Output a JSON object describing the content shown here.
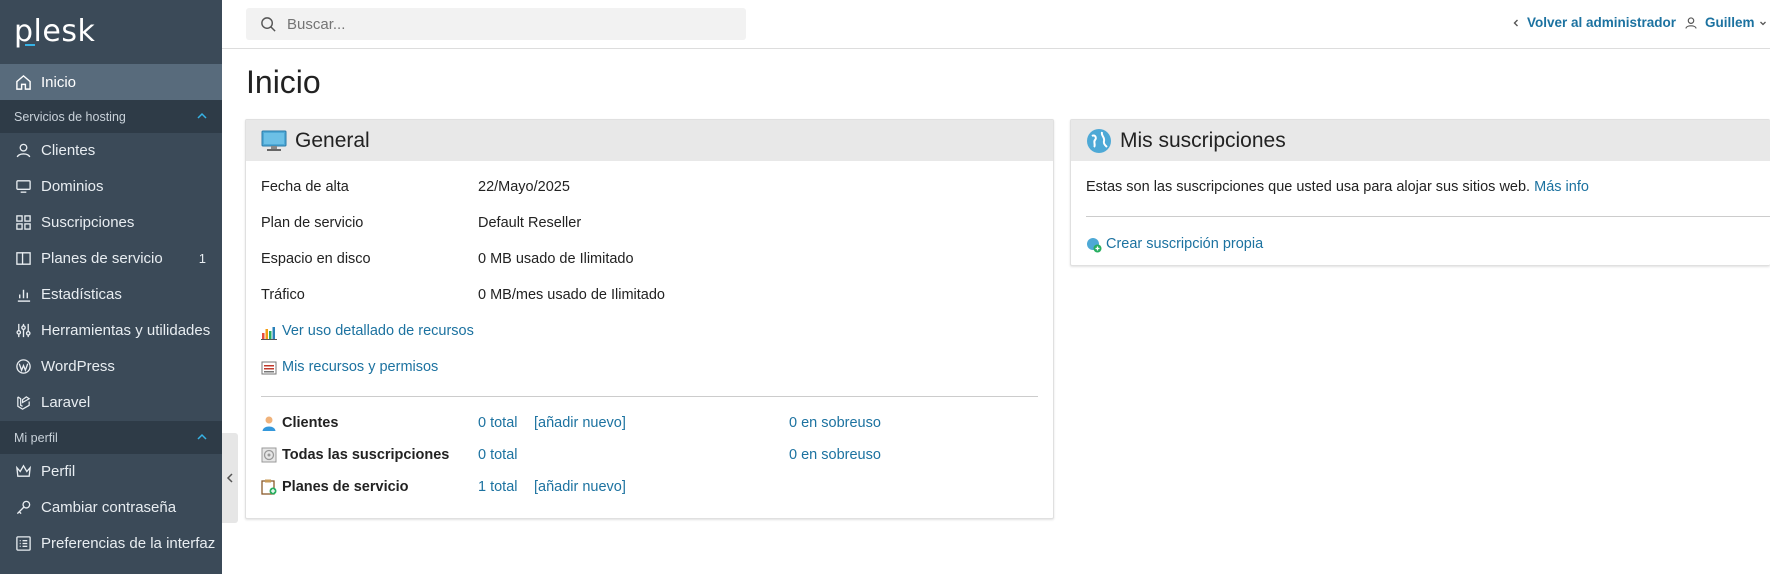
{
  "sidebar": {
    "logo": "plesk",
    "items": [
      {
        "label": "Inicio",
        "icon": "home-icon",
        "active": true
      },
      {
        "label": "Clientes",
        "icon": "user-icon"
      },
      {
        "label": "Dominios",
        "icon": "monitor-icon"
      },
      {
        "label": "Suscripciones",
        "icon": "grid-icon"
      },
      {
        "label": "Planes de servicio",
        "icon": "book-icon",
        "count": "1"
      },
      {
        "label": "Estadísticas",
        "icon": "bar-chart-icon"
      },
      {
        "label": "Herramientas y utilidades",
        "icon": "sliders-icon"
      },
      {
        "label": "WordPress",
        "icon": "wordpress-icon"
      },
      {
        "label": "Laravel",
        "icon": "laravel-icon"
      },
      {
        "label": "Perfil",
        "icon": "crown-icon"
      },
      {
        "label": "Cambiar contraseña",
        "icon": "key-icon"
      },
      {
        "label": "Preferencias de la interfaz",
        "icon": "list-icon"
      }
    ],
    "sections": [
      {
        "label": "Servicios de hosting"
      },
      {
        "label": "Mi perfil"
      }
    ]
  },
  "header": {
    "search_placeholder": "Buscar...",
    "back_link": "Volver al administrador",
    "user": "Guillem"
  },
  "page": {
    "title": "Inicio"
  },
  "general": {
    "title": "General",
    "rows": [
      {
        "label": "Fecha de alta",
        "value": "22/Mayo/2025"
      },
      {
        "label": "Plan de servicio",
        "value": "Default Reseller"
      },
      {
        "label": "Espacio en disco",
        "value": "0 MB usado de Ilimitado"
      },
      {
        "label": "Tráfico",
        "value": "0 MB/mes usado de Ilimitado"
      }
    ],
    "links": {
      "usage": "Ver uso detallado de recursos",
      "resources": "Mis recursos y permisos"
    },
    "summary": [
      {
        "label": "Clientes",
        "total": "0 total",
        "add": "[añadir nuevo]",
        "overuse": "0 en sobreuso"
      },
      {
        "label": "Todas las suscripciones",
        "total": "0 total",
        "add": "",
        "overuse": "0 en sobreuso"
      },
      {
        "label": "Planes de servicio",
        "total": "1 total",
        "add": "[añadir nuevo]",
        "overuse": ""
      }
    ]
  },
  "subscriptions": {
    "title": "Mis suscripciones",
    "description": "Estas son las suscripciones que usted usa para alojar sus sitios web.",
    "more_info": "Más info",
    "create": "Crear suscripción propia"
  },
  "colors": {
    "sidebar_bg": "#3b4a58",
    "sidebar_active": "#586b7c",
    "section_bg": "#2e3b47",
    "link": "#1c72a0",
    "accent": "#36b3e6"
  }
}
